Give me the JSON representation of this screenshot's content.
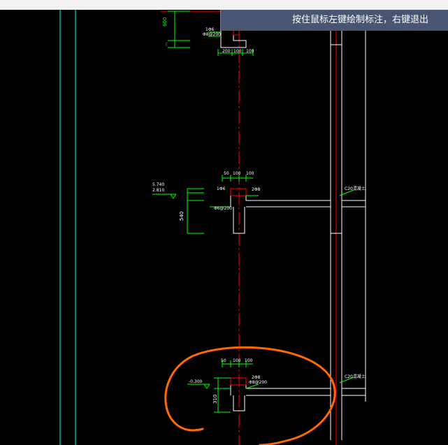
{
  "app": {
    "tooltip": "按住鼠标左键绘制标注，右键退出"
  },
  "colors": {
    "background": "#000000",
    "wall_line": "#ffffff",
    "axis_line": "#ff0000",
    "dimension": "#00ff00",
    "guide_line": "#00ffff",
    "annotation_mark": "#ff6600",
    "tooltip_bg": "#4a5573"
  },
  "drawing": {
    "top_section": {
      "dim_side": "600",
      "beam_label": "1Φ6",
      "stirrup_label": "Φ8@200",
      "dim_bottom": [
        "200",
        "100",
        "100"
      ]
    },
    "middle_section": {
      "elev_top": "5.740",
      "elev_bottom": "2.810",
      "dim_side": "540",
      "dim_top": [
        "50",
        "100",
        "100"
      ],
      "rebar_left": "1Φ6",
      "rebar_right": "2Φ8",
      "stirrup_label": "Φ6@200",
      "grid_label": "C20混凝土"
    },
    "bottom_section": {
      "elev_label": "-0.300",
      "dim_side": "310",
      "dim_top": [
        "50",
        "100",
        "100"
      ],
      "rebar_right": "2Φ8",
      "stirrup_label": "Φ8@200",
      "grid_label": "C20混凝土"
    }
  }
}
